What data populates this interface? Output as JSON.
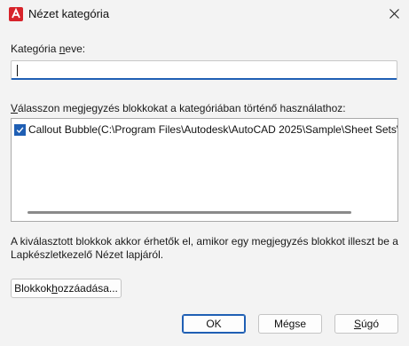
{
  "window": {
    "title": "Nézet kategória",
    "icon": "autocad-app-icon"
  },
  "category_name": {
    "label_before": "Kategória ",
    "label_accel": "n",
    "label_after": "eve:",
    "value": ""
  },
  "blocks_section": {
    "label_accel": "V",
    "label_rest": "álasszon megjegyzés blokkokat a kategóriában történő használathoz:",
    "items": [
      {
        "checked": true,
        "text": "Callout Bubble(C:\\Program Files\\Autodesk\\AutoCAD 2025\\Sample\\Sheet Sets\\Architectu"
      }
    ]
  },
  "info_text": "A kiválasztott blokkok akkor érhetők el, amikor egy megjegyzés blokkot illeszt be a Lapkészletkezelő Nézet lapjáról.",
  "buttons": {
    "add_blocks": {
      "before": "Blokkok ",
      "accel": "h",
      "after": "ozzáadása..."
    },
    "ok": "OK",
    "cancel": "Mégse",
    "help": {
      "accel": "S",
      "after": "úgó"
    }
  },
  "colors": {
    "accent": "#1f5fb4",
    "app_icon": "#d7232a"
  }
}
